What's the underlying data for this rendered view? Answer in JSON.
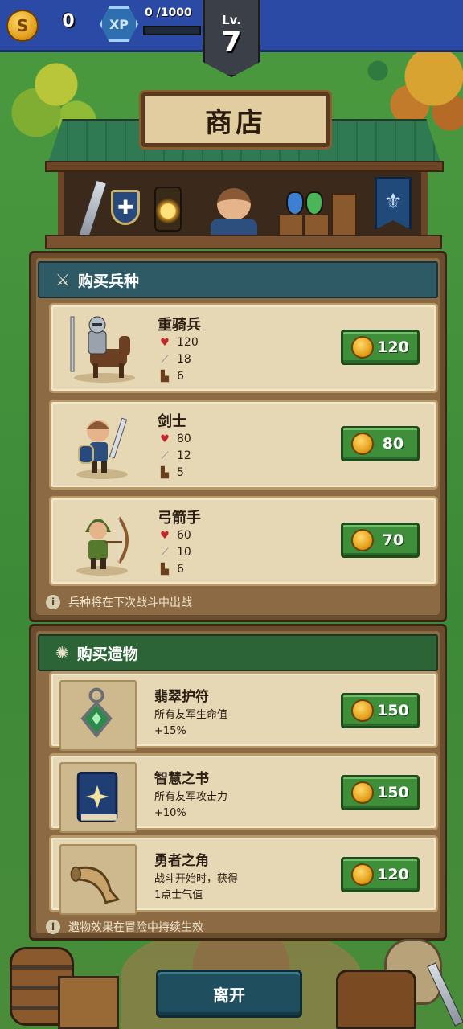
{
  "top_bar": {
    "coin_symbol": "S",
    "coins": "0",
    "xp_label": "XP",
    "xp_current": "0",
    "xp_max": "/1000",
    "xp_progress": 0,
    "level_label": "Lv.",
    "level": "7"
  },
  "shop": {
    "title": "商店"
  },
  "units_section": {
    "title": "购买兵种",
    "units": [
      {
        "name": "重骑兵",
        "hp": "120",
        "attack": "18",
        "speed": "6",
        "price": "120"
      },
      {
        "name": "剑士",
        "hp": "80",
        "attack": "12",
        "speed": "5",
        "price": "80"
      },
      {
        "name": "弓箭手",
        "hp": "60",
        "attack": "10",
        "speed": "6",
        "price": "70"
      }
    ],
    "info": "兵种将在下次战斗中出战"
  },
  "relics_section": {
    "title": "购买遗物",
    "relics": [
      {
        "name": "翡翠护符",
        "desc_line1": "所有友军生命值",
        "desc_line2": "+15%",
        "price": "150"
      },
      {
        "name": "智慧之书",
        "desc_line1": "所有友军攻击力",
        "desc_line2": "+10%",
        "price": "150"
      },
      {
        "name": "勇者之角",
        "desc_line1": "战斗开始时，获得",
        "desc_line2": "1点士气值",
        "price": "120"
      }
    ],
    "info": "遗物效果在冒险中持续生效"
  },
  "leave_button": "离开",
  "colors": {
    "top_bar": "#2a4aa6",
    "units_header": "#2e5a66",
    "relics_header": "#2c6438",
    "price_button": "#3e8e3a",
    "leave_button": "#1f4f5e"
  }
}
